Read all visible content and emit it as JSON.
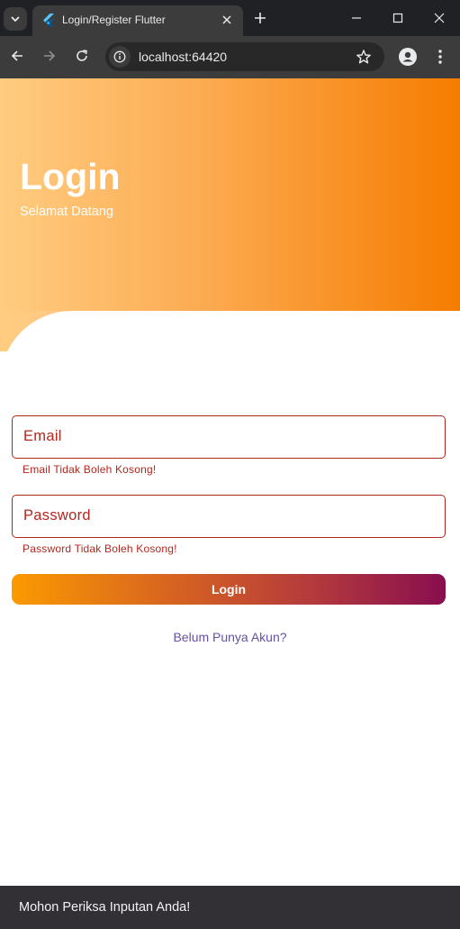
{
  "browser": {
    "tab_title": "Login/Register Flutter",
    "url": "localhost:64420"
  },
  "header": {
    "title": "Login",
    "subtitle": "Selamat Datang"
  },
  "form": {
    "email": {
      "label": "Email",
      "error": "Email Tidak Boleh Kosong!"
    },
    "password": {
      "label": "Password",
      "error": "Password Tidak Boleh Kosong!"
    },
    "login_button": "Login",
    "register_link": "Belum Punya Akun?"
  },
  "snackbar": {
    "message": "Mohon Periksa Inputan Anda!"
  },
  "colors": {
    "header_gradient_start": "#ffcc80",
    "header_gradient_end": "#f57c00",
    "error": "#b3261e",
    "button_gradient_start": "#fb9a00",
    "button_gradient_end": "#880e4f",
    "link": "#6750a4",
    "snackbar_bg": "#322f35"
  }
}
